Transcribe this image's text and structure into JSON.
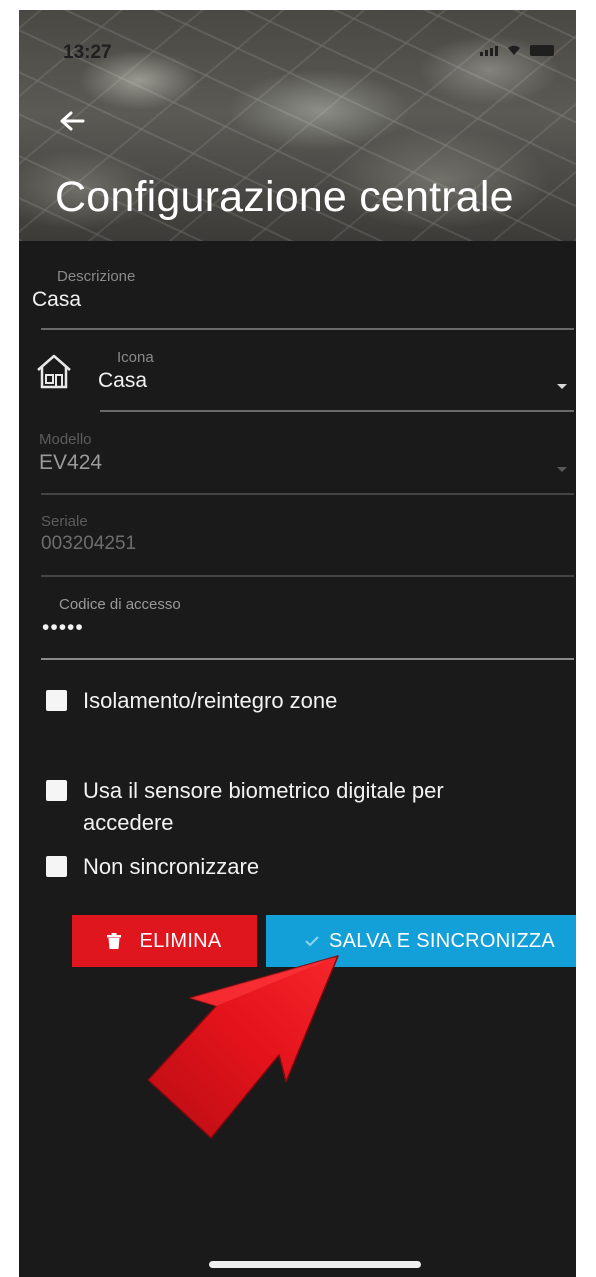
{
  "status_bar": {
    "time": "13:27"
  },
  "header": {
    "title": "Configurazione centrale"
  },
  "form": {
    "descrizione": {
      "label": "Descrizione",
      "value": "Casa"
    },
    "icona": {
      "label": "Icona",
      "value": "Casa",
      "icon": "house-icon"
    },
    "modello": {
      "label": "Modello",
      "value": "EV424"
    },
    "seriale": {
      "label": "Seriale",
      "value": "003204251"
    },
    "codice": {
      "label": "Codice di accesso",
      "value": "•••••"
    }
  },
  "checkboxes": {
    "isolamento": "Isolamento/reintegro zone",
    "biometrico_line1": "Usa il sensore biometrico digitale per",
    "biometrico_line2": "accedere",
    "non_sincronizzare": "Non sincronizzare"
  },
  "buttons": {
    "delete_label": "ELIMINA",
    "save_label": "SALVA E SINCRONIZZA"
  },
  "colors": {
    "delete": "#e0161f",
    "save": "#13a0d8",
    "annotation_arrow": "#e5131b",
    "background": "#1a1a1a"
  }
}
